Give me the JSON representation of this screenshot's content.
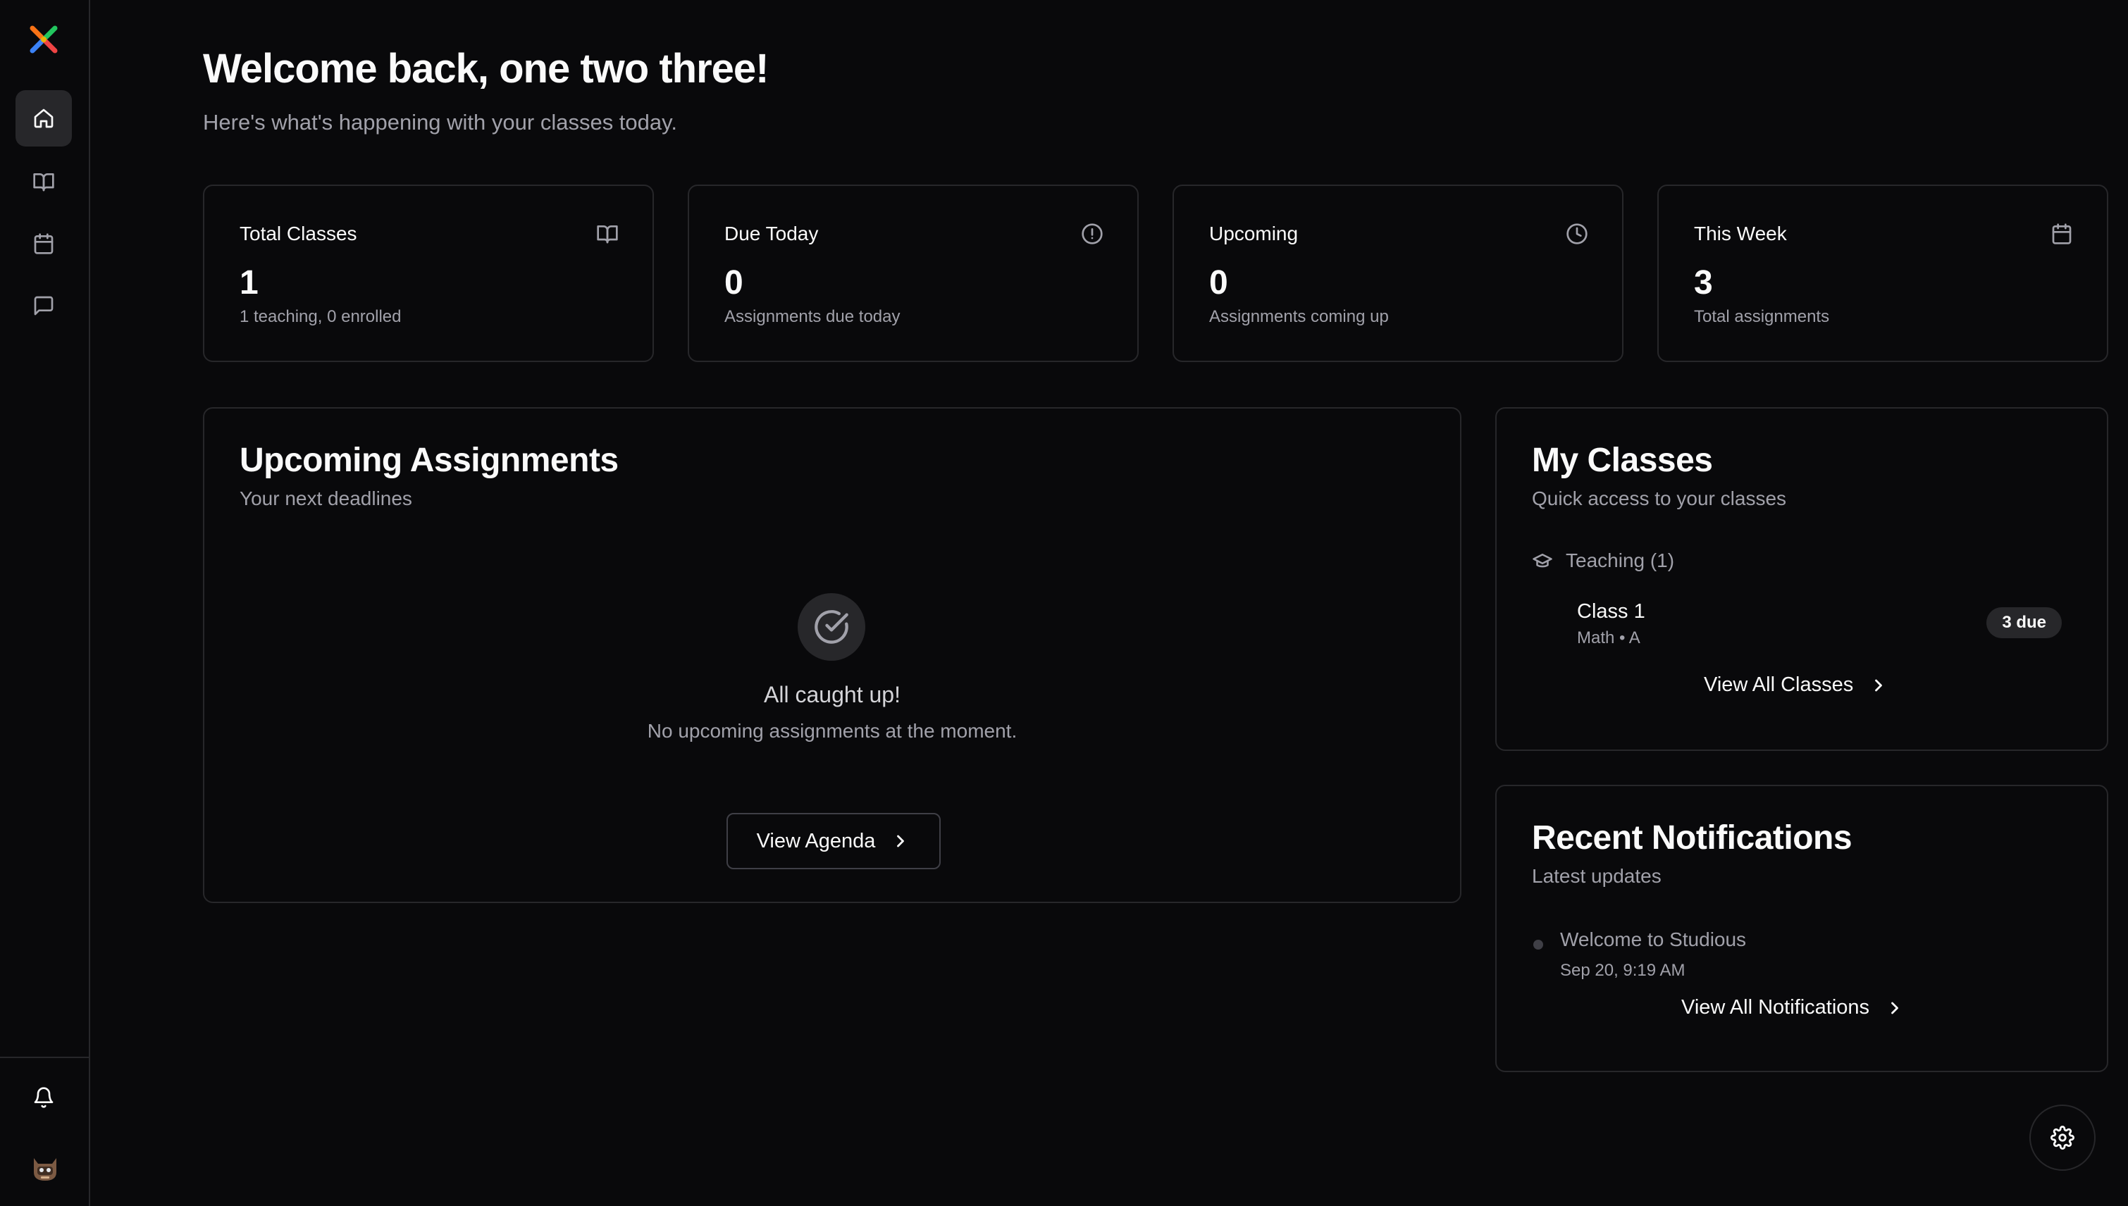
{
  "app": {
    "name": "Studious"
  },
  "sidebar": {
    "logo_icon": "app-logo-icon",
    "items": [
      {
        "name": "home",
        "icon": "home-icon",
        "active": true
      },
      {
        "name": "classes",
        "icon": "book-open-icon",
        "active": false
      },
      {
        "name": "calendar",
        "icon": "calendar-icon",
        "active": false
      },
      {
        "name": "messages",
        "icon": "message-square-icon",
        "active": false
      }
    ],
    "bottom": [
      {
        "name": "notifications",
        "icon": "bell-icon"
      },
      {
        "name": "profile",
        "icon": "avatar-icon"
      }
    ]
  },
  "header": {
    "title": "Welcome back, one two three!",
    "subtitle": "Here's what's happening with your classes today."
  },
  "stats": [
    {
      "label": "Total Classes",
      "value": "1",
      "description": "1 teaching, 0 enrolled",
      "icon": "book-open-icon"
    },
    {
      "label": "Due Today",
      "value": "0",
      "description": "Assignments due today",
      "icon": "alert-circle-icon"
    },
    {
      "label": "Upcoming",
      "value": "0",
      "description": "Assignments coming up",
      "icon": "clock-icon"
    },
    {
      "label": "This Week",
      "value": "3",
      "description": "Total assignments",
      "icon": "calendar-icon"
    }
  ],
  "upcoming_assignments": {
    "title": "Upcoming Assignments",
    "subtitle": "Your next deadlines",
    "empty_title": "All caught up!",
    "empty_description": "No upcoming assignments at the moment.",
    "button_label": "View Agenda"
  },
  "my_classes": {
    "title": "My Classes",
    "subtitle": "Quick access to your classes",
    "group_label": "Teaching (1)",
    "classes": [
      {
        "name": "Class 1",
        "meta": "Math • A",
        "badge": "3 due"
      }
    ],
    "link_label": "View All Classes"
  },
  "notifications": {
    "title": "Recent Notifications",
    "subtitle": "Latest updates",
    "items": [
      {
        "title": "Welcome to Studious",
        "time": "Sep 20, 9:19 AM"
      }
    ],
    "link_label": "View All Notifications"
  },
  "colors": {
    "background": "#09090b",
    "border": "#27272a",
    "text": "#fafafa",
    "muted": "#a1a1aa"
  }
}
